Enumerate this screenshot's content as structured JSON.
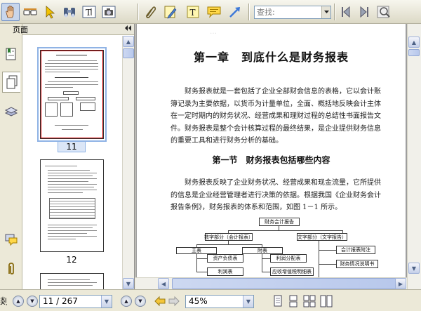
{
  "toolbar": {
    "find_placeholder": "查找:",
    "icons": [
      "hand-tool-icon",
      "reader-glasses-icon",
      "select-arrow-icon",
      "find-binoculars-icon",
      "text-select-icon",
      "snapshot-camera-icon",
      "attach-tool-icon",
      "edit-note-icon",
      "text-box-icon",
      "comment-icon",
      "arrow-tool-icon",
      "find-previous-icon",
      "find-next-icon",
      "find-options-icon"
    ]
  },
  "panel": {
    "title": "页面",
    "thumbnails": [
      {
        "label": "11",
        "selected": true
      },
      {
        "label": "12",
        "selected": false
      }
    ]
  },
  "rail": {
    "tabs": [
      "bookmark-panel-icon",
      "pages-panel-icon",
      "layers-panel-icon",
      "comments-panel-icon",
      "attachments-panel-icon"
    ]
  },
  "document": {
    "chapter_title": "第一章　到底什么是财务报表",
    "paragraph1": "财务报表就是一套包括了企业全部财会信息的表格，它以会计账簿记录为主要依据，以货币为计量单位，全面、概括地反映会计主体在一定时期内的财务状况、经营成果和理财过程的总结性书面报告文件。财务报表是整个会计核算过程的最终结果，是企业提供财务信息的重要工具和进行财务分析的基础。",
    "section_title": "第一节　财务报表包括哪些内容",
    "paragraph2": "财务报表反映了企业财务状况、经营成果和现金流量，它所提供的信息是企业经营管理者进行决策的依据。根据我国《企业财务会计报告条例》，财务报表的体系和范围，如图 1－1 所示。",
    "diagram": {
      "root": "财务会计报告",
      "numeric": "数字部分（会计报表）",
      "text": "文字部分（文字报告）",
      "main": "主表",
      "attached": "附表",
      "notes": "会计报表附注",
      "explain": "财务情况说明书",
      "balance": "资产负债表",
      "profit_dist": "利润分配表",
      "income": "利润表",
      "vat": "应收增值税明细表"
    }
  },
  "status": {
    "page_field": "11 / 267",
    "zoom_field": "45%",
    "truncated_left": "剡"
  }
}
